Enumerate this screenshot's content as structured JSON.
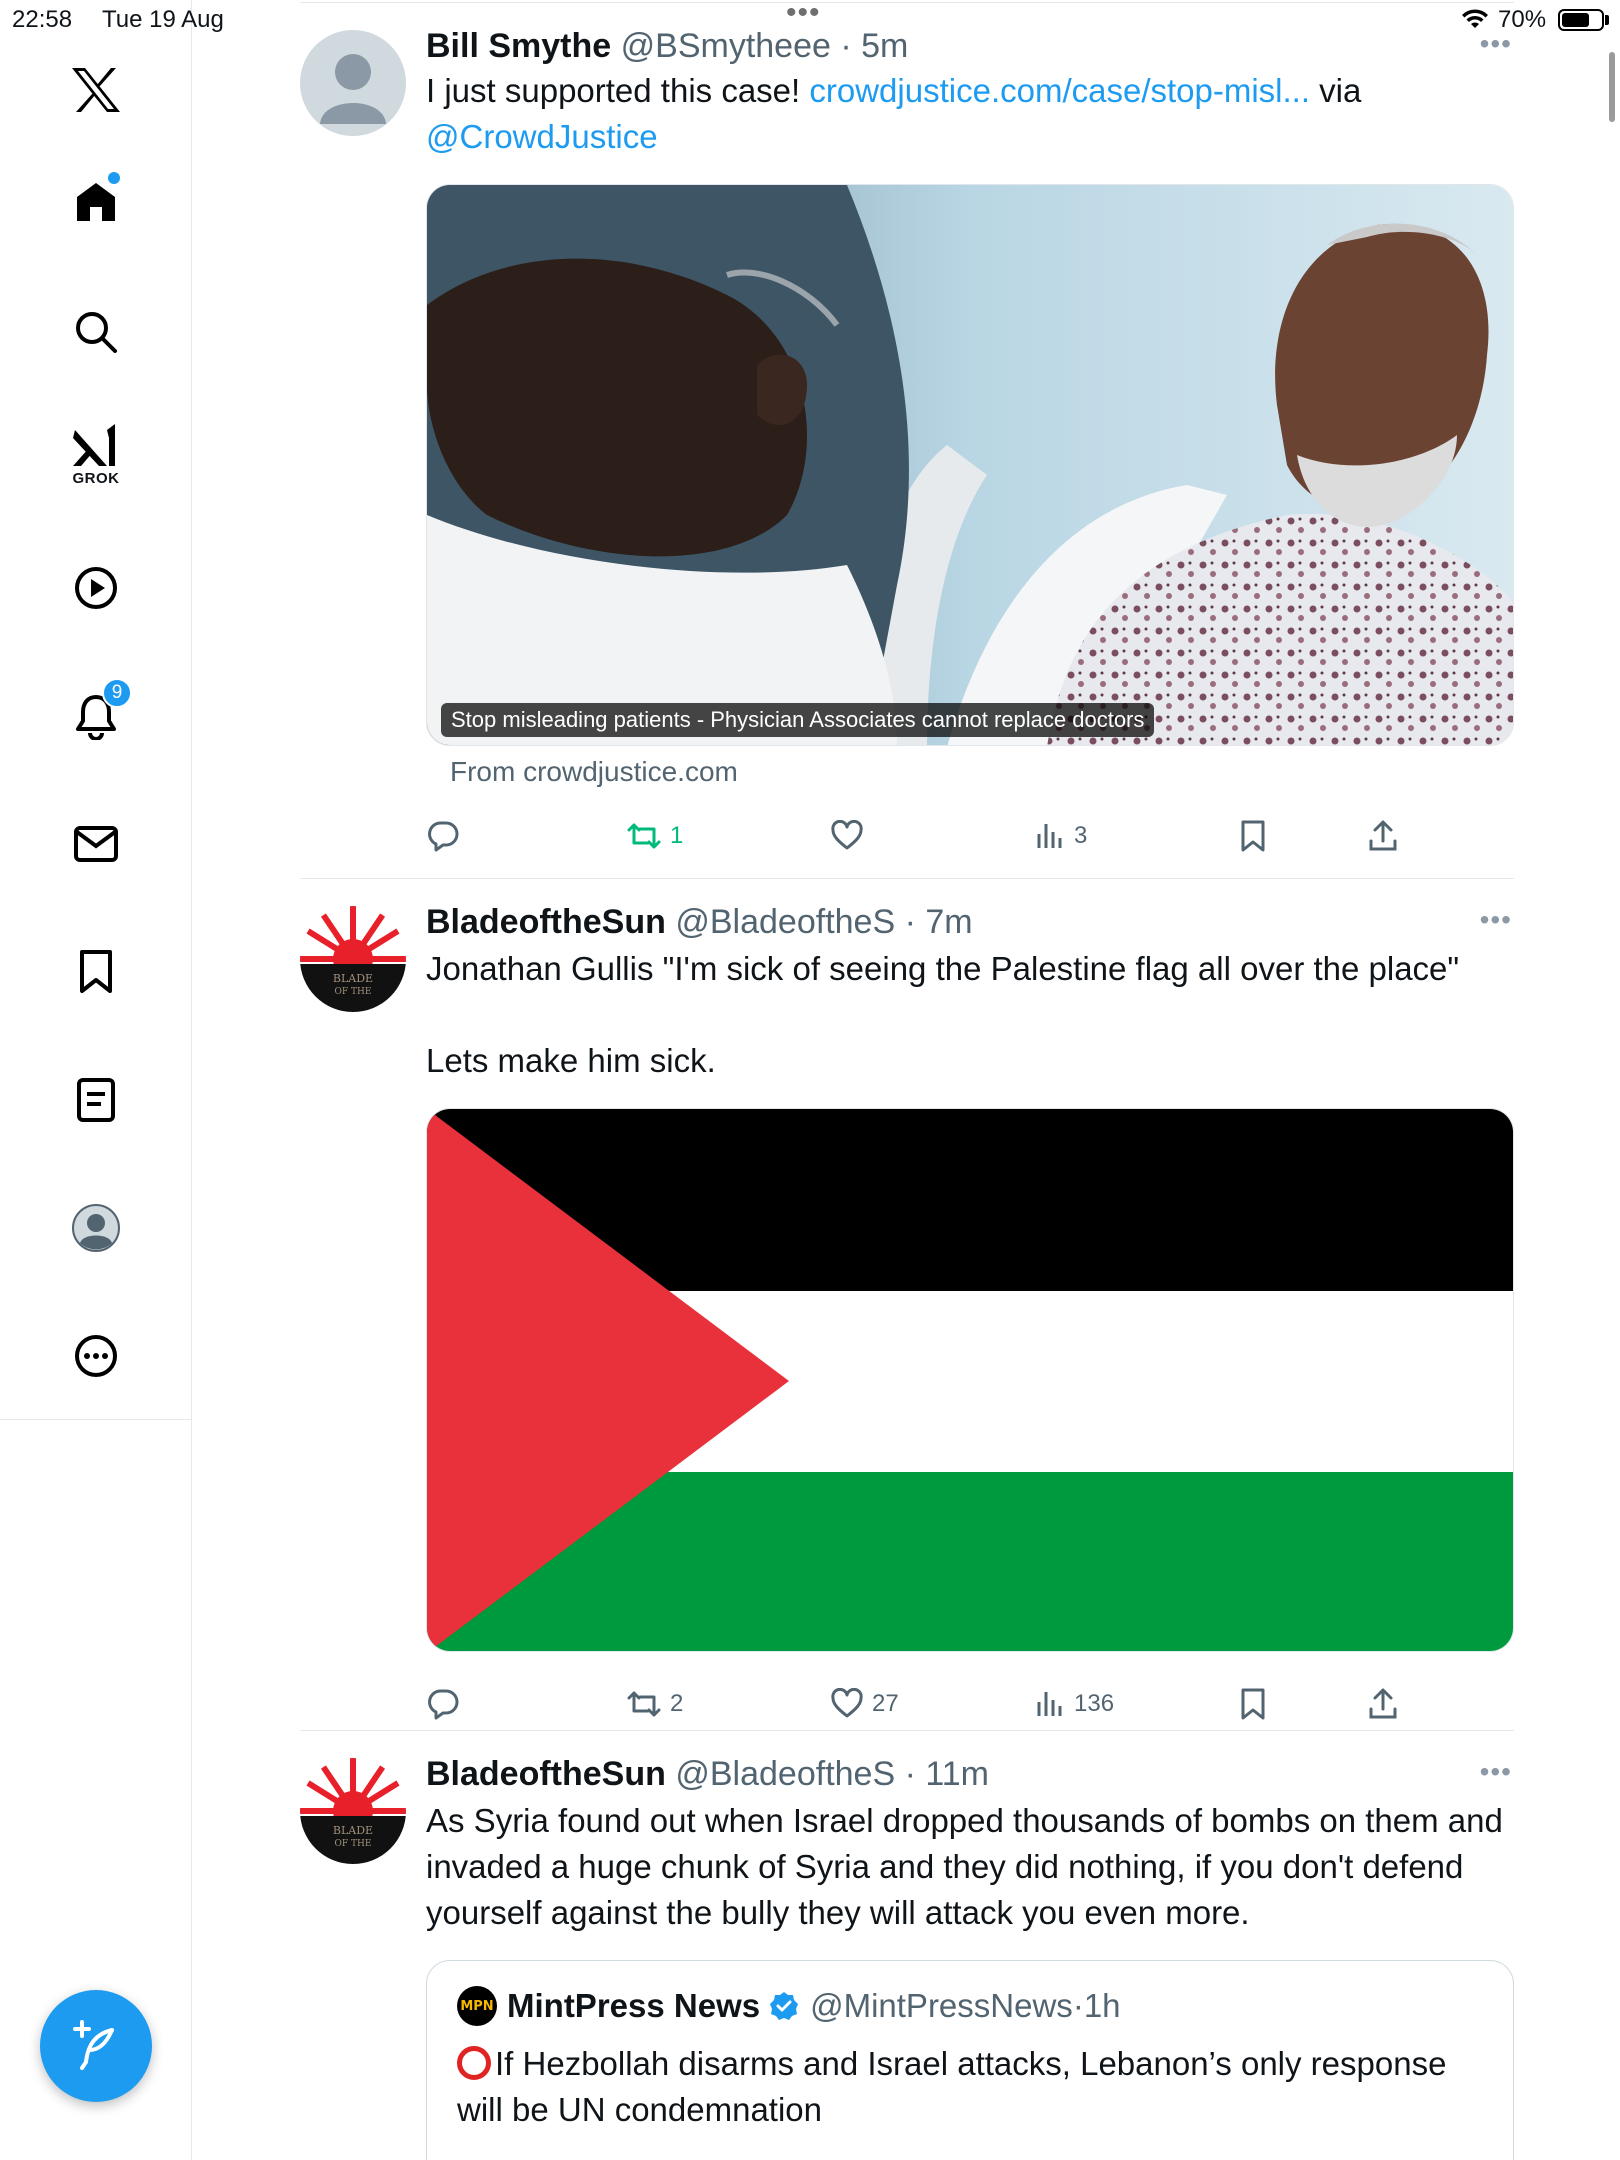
{
  "status_bar": {
    "time": "22:58",
    "date": "Tue 19 Aug",
    "battery_text": "70%",
    "battery_level": 0.7
  },
  "sidebar": {
    "logo_icon": "x-logo-icon",
    "items": [
      {
        "name": "home",
        "icon": "home-icon",
        "has_dot": true
      },
      {
        "name": "explore",
        "icon": "search-icon"
      },
      {
        "name": "grok",
        "icon": "grok-icon",
        "label": "GROK"
      },
      {
        "name": "video",
        "icon": "play-icon"
      },
      {
        "name": "notifications",
        "icon": "bell-icon",
        "badge": "9"
      },
      {
        "name": "messages",
        "icon": "mail-icon"
      },
      {
        "name": "bookmarks",
        "icon": "bookmark-icon"
      },
      {
        "name": "lists",
        "icon": "list-icon"
      },
      {
        "name": "profile",
        "icon": "profile-icon"
      },
      {
        "name": "more",
        "icon": "more-icon"
      }
    ],
    "compose_icon": "compose-icon",
    "accent": "#1d9bf0"
  },
  "tweets": [
    {
      "name": "Bill Smythe",
      "handle": "@BSmytheee",
      "time": "5m",
      "text_prefix": "I just supported this case! ",
      "link": "crowdjustice.com/case/stop-misl...",
      "text_mid": " via",
      "mention": "@CrowdJustice",
      "card_caption": "Stop misleading patients - Physician Associates cannot replace doctors",
      "card_source": "From crowdjustice.com",
      "replies": "",
      "reposts": "1",
      "likes": "",
      "views": "3",
      "reposted_color": "#00ba7c"
    },
    {
      "name": "BladeoftheSun",
      "handle": "@BladeoftheS",
      "time": "7m",
      "text_line1": "Jonathan Gullis \"I'm sick of seeing the Palestine flag all over the place\"",
      "text_line2": "Lets make him sick.",
      "replies": "",
      "reposts": "2",
      "likes": "27",
      "views": "136",
      "flag_colors": {
        "black": "#000000",
        "white": "#ffffff",
        "green": "#009a3e",
        "red": "#e8313a"
      }
    },
    {
      "name": "BladeoftheSun",
      "handle": "@BladeoftheS",
      "time": "11m",
      "text": "As Syria found out when Israel dropped thousands of bombs on them and invaded a huge chunk of Syria and they did nothing, if you don't defend yourself against the bully they will attack you even more.",
      "quote": {
        "logo_text": "MPN",
        "name": "MintPress News",
        "handle": "@MintPressNews",
        "time": "1h",
        "verified": true,
        "text": "If Hezbollah disarms and Israel attacks, Lebanon’s only response will be UN condemnation"
      }
    }
  ]
}
